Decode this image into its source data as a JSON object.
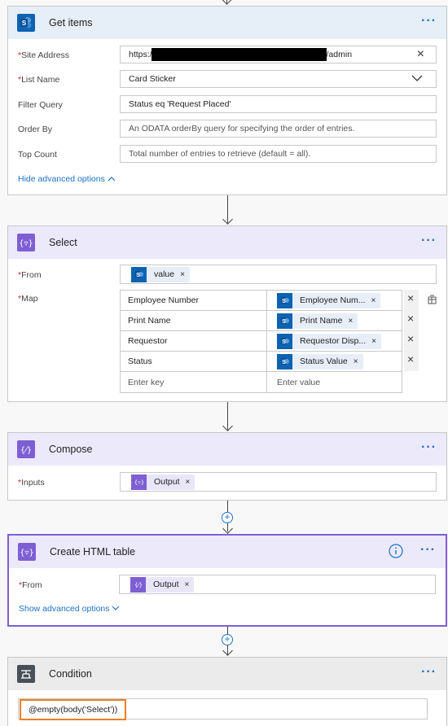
{
  "get_items": {
    "title": "Get items",
    "more": "···",
    "fields": [
      {
        "label": "Site Address",
        "required": true,
        "prefix": "https://",
        "suffix": "/admin"
      },
      {
        "label": "List Name",
        "required": true,
        "value": "Card Sticker"
      },
      {
        "label": "Filter Query",
        "required": false,
        "value": "Status eq 'Request Placed'"
      },
      {
        "label": "Order By",
        "required": false,
        "placeholder": "An ODATA orderBy query for specifying the order of entries."
      },
      {
        "label": "Top Count",
        "required": false,
        "placeholder": "Total number of entries to retrieve (default = all)."
      }
    ],
    "advanced_link": "Hide advanced options"
  },
  "select": {
    "title": "Select",
    "more": "···",
    "from_label": "From",
    "from_token": "value",
    "map_label": "Map",
    "map_rows": [
      {
        "key": "Employee Number",
        "value": "Employee Num..."
      },
      {
        "key": "Print Name",
        "value": "Print Name"
      },
      {
        "key": "Requestor",
        "value": "Requestor Disp..."
      },
      {
        "key": "Status",
        "value": "Status Value"
      }
    ],
    "key_placeholder": "Enter key",
    "value_placeholder": "Enter value"
  },
  "compose": {
    "title": "Compose",
    "more": "···",
    "inputs_label": "Inputs",
    "inputs_token": "Output"
  },
  "html_table": {
    "title": "Create HTML table",
    "more": "···",
    "from_label": "From",
    "from_token": "Output",
    "advanced_link": "Show advanced options"
  },
  "condition": {
    "title": "Condition",
    "more": "···",
    "expression": "@empty(body('Select'))"
  },
  "colors": {
    "accent": "#1a72c4",
    "sharepoint": "#0d63b2",
    "data_ops": "#7e5fd3",
    "highlight": "#f07d22"
  }
}
